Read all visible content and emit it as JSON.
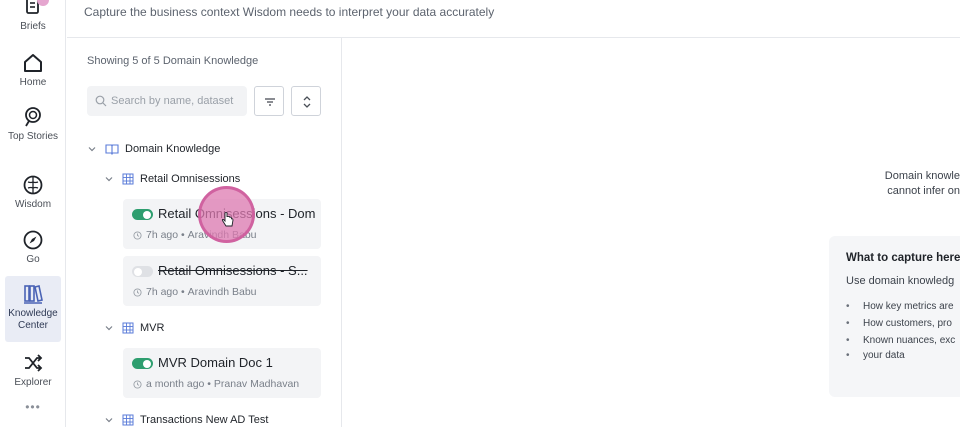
{
  "header": {
    "subtitle": "Capture the business context Wisdom needs to interpret your data accurately"
  },
  "sidebar": {
    "items": [
      {
        "label": "Briefs",
        "icon": "briefs-icon"
      },
      {
        "label": "Home",
        "icon": "home-icon"
      },
      {
        "label": "Top Stories",
        "icon": "top-stories-icon"
      },
      {
        "label": "Wisdom",
        "icon": "brain-icon"
      },
      {
        "label": "Go",
        "icon": "compass-icon"
      },
      {
        "label": "Knowledge Center",
        "icon": "books-icon",
        "active": true
      },
      {
        "label": "Explorer",
        "icon": "shuffle-icon"
      }
    ],
    "more": "•••"
  },
  "panel": {
    "count_text": "Showing 5 of 5 Domain Knowledge",
    "search_placeholder": "Search by name, dataset",
    "root": {
      "label": "Domain Knowledge"
    },
    "groups": [
      {
        "label": "Retail Omnisessions",
        "docs": [
          {
            "title": "Retail Omnisessions - Dom",
            "time": "7h ago",
            "author": "Aravindh Babu",
            "enabled": true
          },
          {
            "title": "Retail Omnisessions - S...",
            "time": "7h ago",
            "author": "Aravindh Babu",
            "enabled": false
          }
        ]
      },
      {
        "label": "MVR",
        "docs": [
          {
            "title": "MVR Domain Doc 1",
            "time": "a month ago",
            "author": "Pranav Madhavan",
            "enabled": true
          }
        ]
      },
      {
        "label": "Transactions New AD Test",
        "docs": []
      }
    ]
  },
  "detail": {
    "hint_line1": "Domain knowle",
    "hint_line2": "cannot infer on",
    "capture_title": "What to capture here?",
    "capture_sub": "Use domain knowledg",
    "bullets": [
      "How key metrics are",
      "How customers, pro",
      "Known nuances, exc",
      "your data"
    ]
  },
  "colors": {
    "toggle_on": "#2e9e6f",
    "toggle_off": "#dfe1e5",
    "active_nav_bg": "#e9ecf5",
    "cursor_highlight": "#de7ab0"
  }
}
